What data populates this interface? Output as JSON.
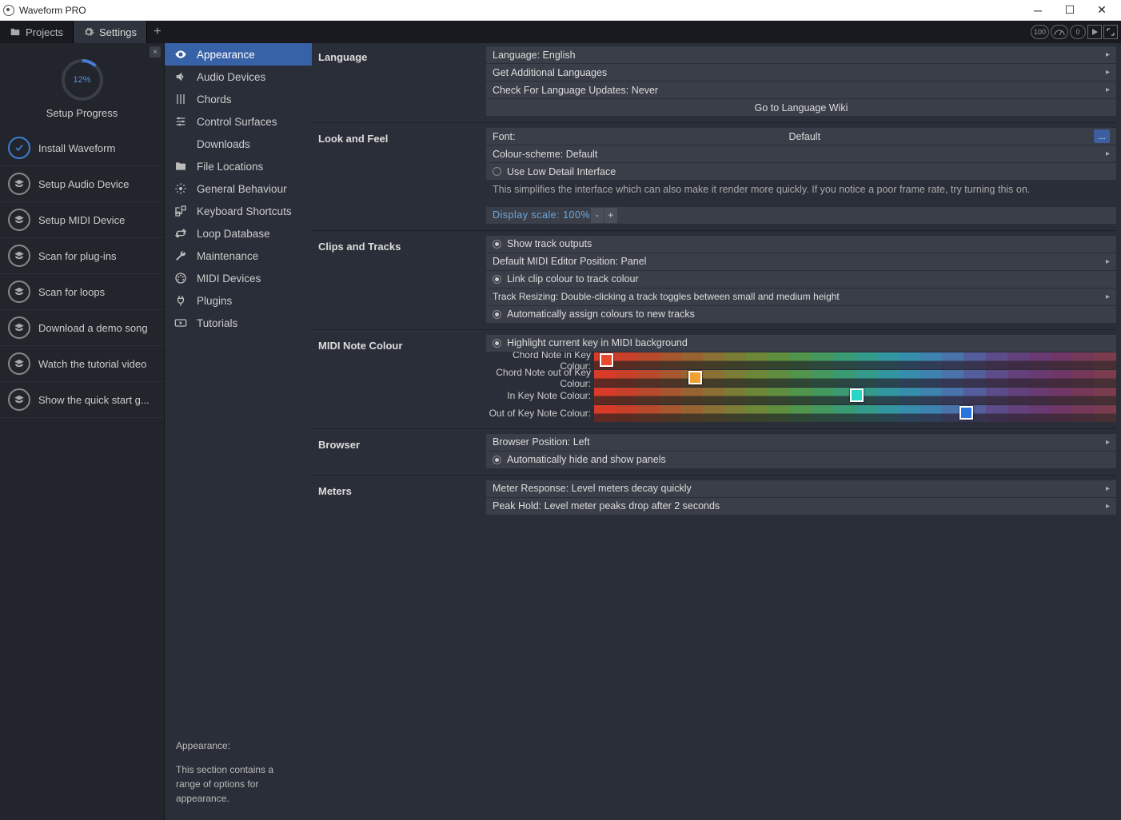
{
  "app": {
    "title": "Waveform PRO"
  },
  "tabs": {
    "projects": "Projects",
    "settings": "Settings"
  },
  "topright": {
    "badge1": "100",
    "badge2": "0"
  },
  "progress": {
    "pct": "12%",
    "title": "Setup Progress",
    "items": [
      {
        "label": "Install Waveform",
        "done": true
      },
      {
        "label": "Setup Audio Device",
        "done": false
      },
      {
        "label": "Setup MIDI Device",
        "done": false
      },
      {
        "label": "Scan for plug-ins",
        "done": false
      },
      {
        "label": "Scan for loops",
        "done": false
      },
      {
        "label": "Download a demo song",
        "done": false
      },
      {
        "label": "Watch the tutorial video",
        "done": false
      },
      {
        "label": "Show the quick start g...",
        "done": false
      }
    ]
  },
  "cats": [
    "Appearance",
    "Audio Devices",
    "Chords",
    "Control Surfaces",
    "Downloads",
    "File Locations",
    "General Behaviour",
    "Keyboard Shortcuts",
    "Loop Database",
    "Maintenance",
    "MIDI Devices",
    "Plugins",
    "Tutorials"
  ],
  "desc": {
    "h": "Appearance:",
    "p": "This section contains a range of options for appearance."
  },
  "sec": {
    "language": {
      "label": "Language",
      "r0": "Language: English",
      "r1": "Get Additional Languages",
      "r2": "Check For Language Updates: Never",
      "r3": "Go to Language Wiki"
    },
    "look": {
      "label": "Look and Feel",
      "font_l": "Font:",
      "font_v": "Default",
      "scheme": "Colour-scheme: Default",
      "lowdetail": "Use Low Detail Interface",
      "note": "This simplifies the interface which can also make it render more quickly. If you notice a poor frame rate, try turning this on.",
      "scale": "Display scale: 100%"
    },
    "clips": {
      "label": "Clips and Tracks",
      "r0": "Show track outputs",
      "r1": "Default MIDI Editor Position: Panel",
      "r2": "Link clip colour to track colour",
      "r3": "Track Resizing: Double-clicking a track toggles between small and medium height",
      "r4": "Automatically assign colours to new tracks"
    },
    "midi": {
      "label": "MIDI Note Colour",
      "r0": "Highlight current key in MIDI background",
      "l0": "Chord Note in Key Colour:",
      "l1": "Chord Note out of Key Colour:",
      "l2": "In Key Note Colour:",
      "l3": "Out of Key Note Colour:"
    },
    "browser": {
      "label": "Browser",
      "r0": "Browser Position: Left",
      "r1": "Automatically hide and show panels"
    },
    "meters": {
      "label": "Meters",
      "r0": "Meter Response: Level meters decay quickly",
      "r1": "Peak Hold: Level meter peaks drop after 2 seconds"
    }
  },
  "colors": {
    "spectrum": [
      "#d83c28",
      "#c8402a",
      "#b8492c",
      "#a85630",
      "#986332",
      "#8a7034",
      "#7b7c36",
      "#6e8638",
      "#5f8e3e",
      "#51944c",
      "#44985e",
      "#3a9a74",
      "#349a8a",
      "#3296a0",
      "#368eac",
      "#3e82b0",
      "#4a73ac",
      "#545e9c",
      "#5c4d8a",
      "#63417c",
      "#6a3a72",
      "#703766",
      "#763858",
      "#7b3c4e"
    ],
    "spectrum_dark": [
      "#5e2a22",
      "#582c23",
      "#523025",
      "#4c3426",
      "#473828",
      "#423c29",
      "#3d3f2a",
      "#38422b",
      "#34442f",
      "#304634",
      "#2c473b",
      "#2a4742",
      "#294649",
      "#2a4450",
      "#2c4155",
      "#303d57",
      "#343855",
      "#38334f",
      "#3b2f49",
      "#3e2c44",
      "#412b40",
      "#432b3b",
      "#452d37",
      "#472f34"
    ],
    "mark0": {
      "left": "1%",
      "bg": "#e84a2e"
    },
    "mark1": {
      "left": "18%",
      "bg": "#f0a030"
    },
    "mark2": {
      "left": "49%",
      "bg": "#28d6c8"
    },
    "mark3": {
      "left": "70%",
      "bg": "#2a74e0"
    }
  }
}
